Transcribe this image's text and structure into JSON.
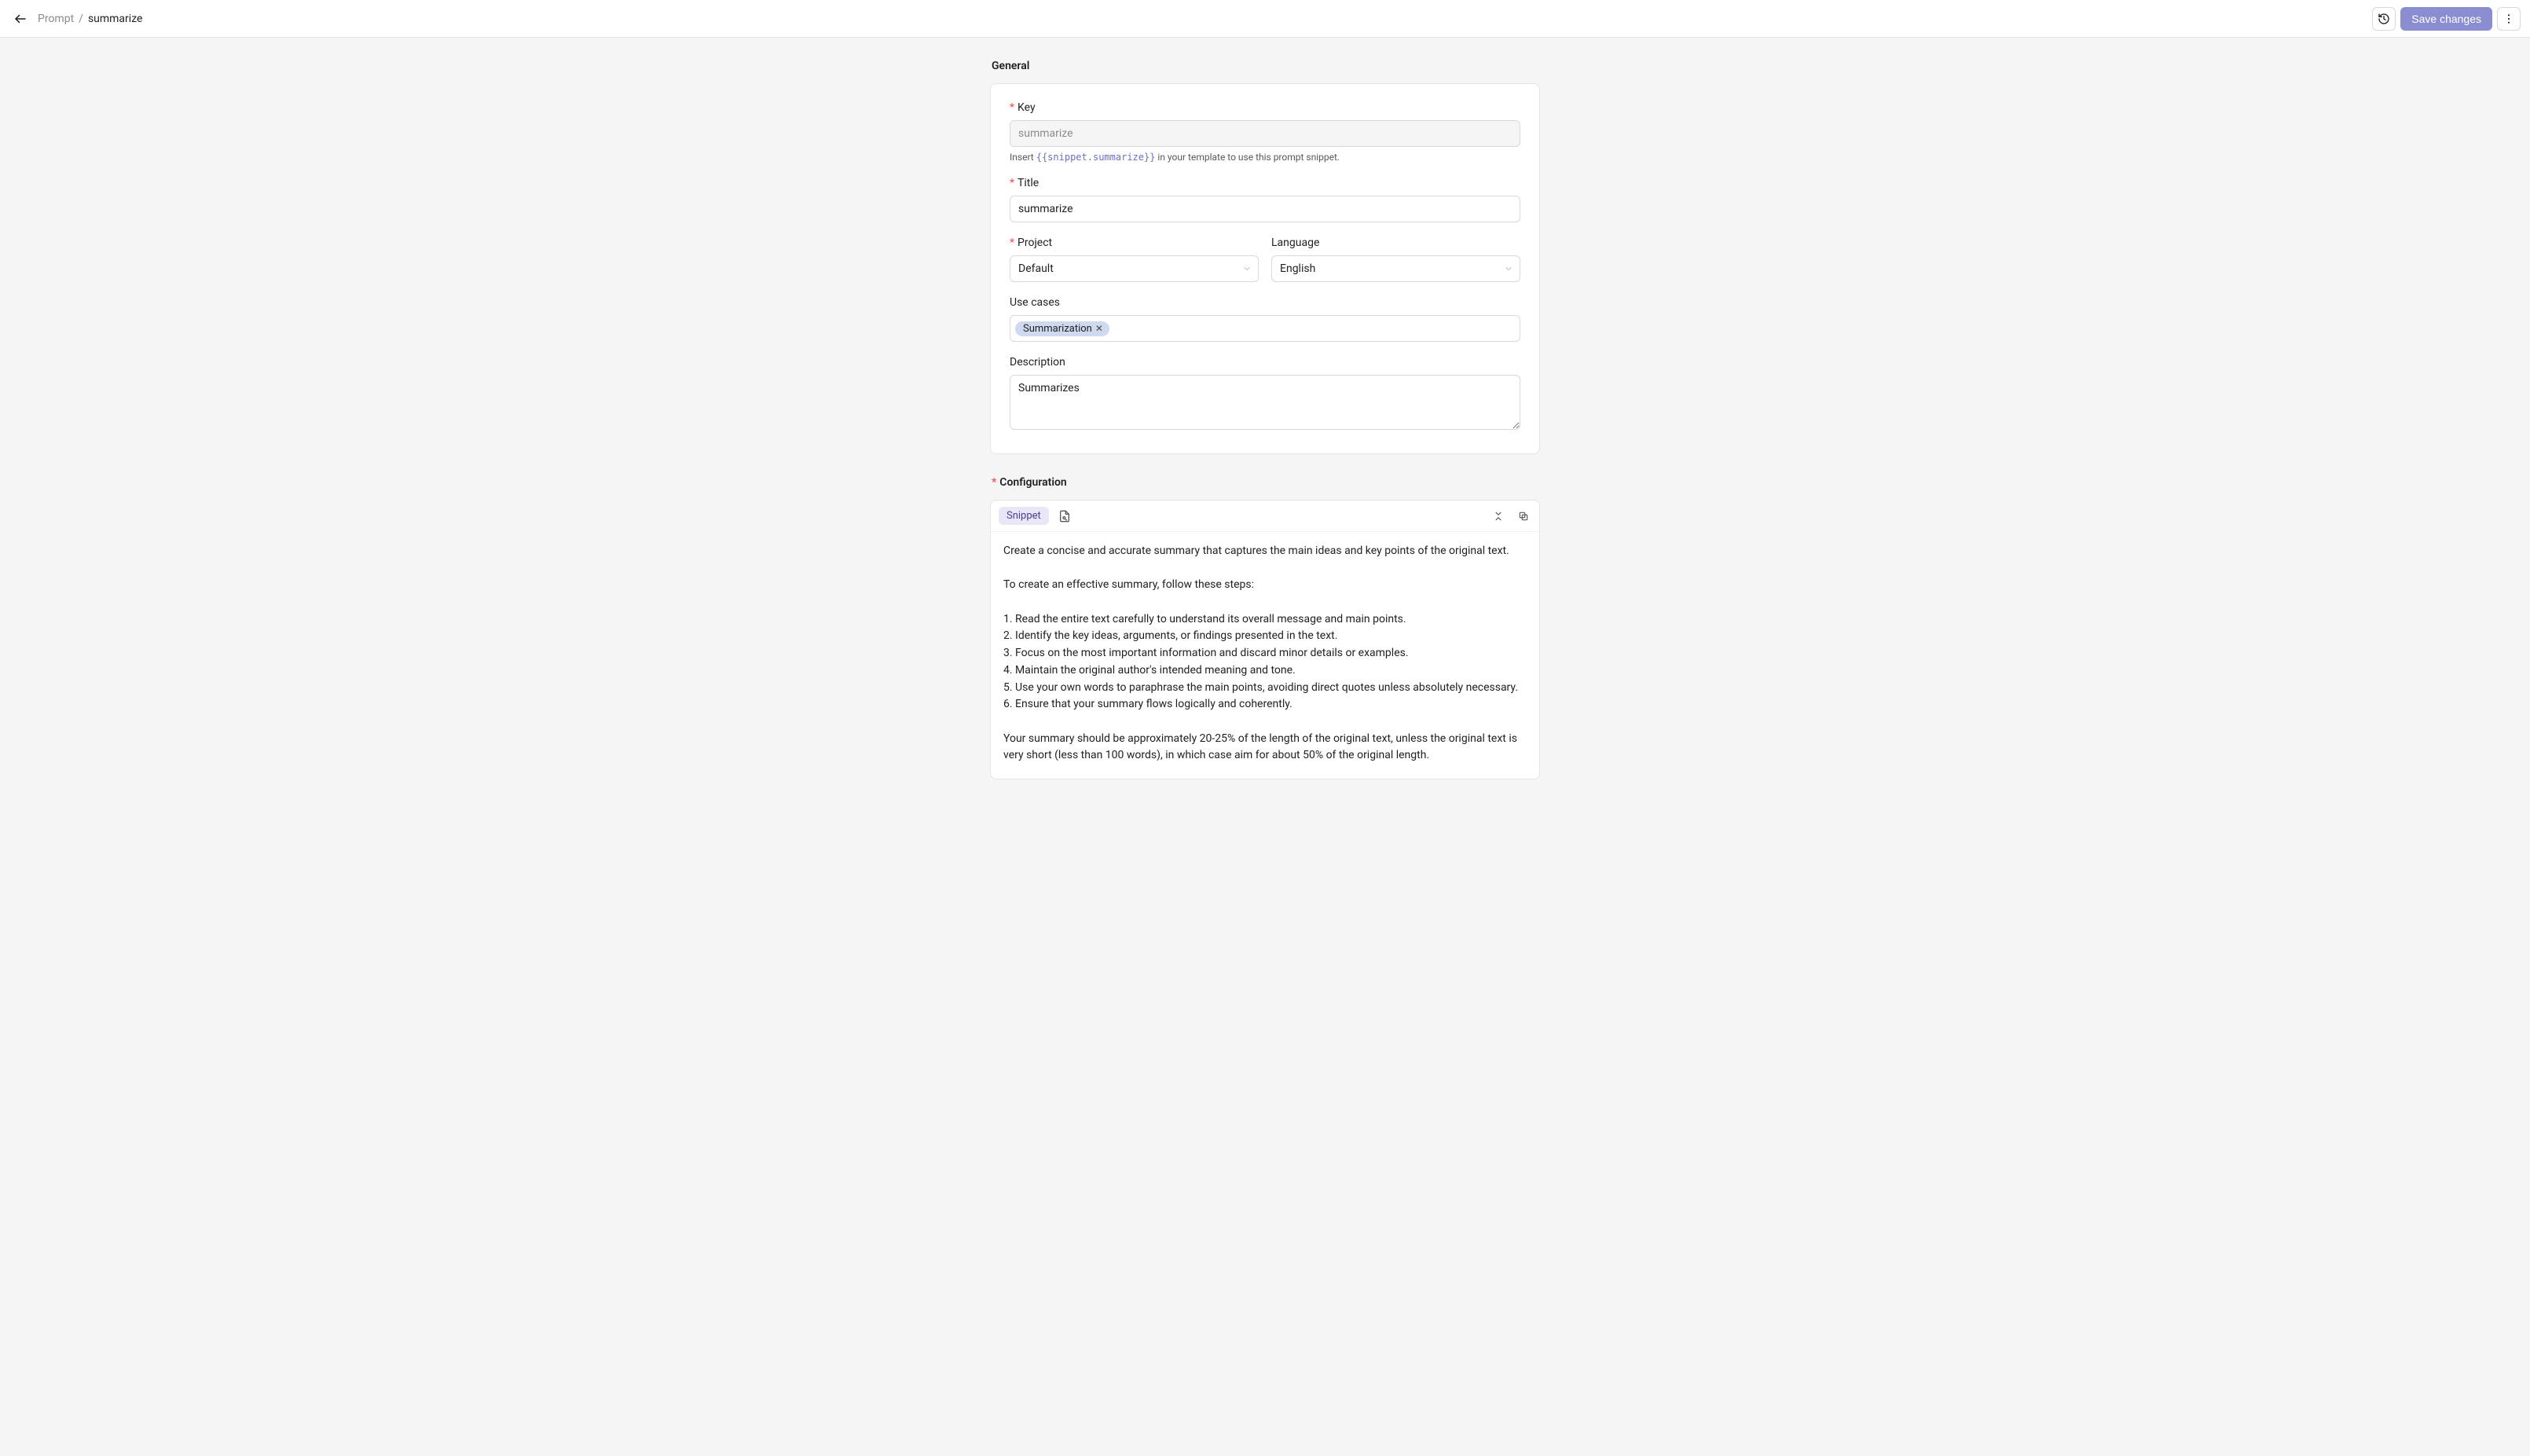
{
  "topbar": {
    "breadcrumb_root": "Prompt",
    "breadcrumb_sep": "/",
    "breadcrumb_leaf": "summarize",
    "save_label": "Save changes"
  },
  "sections": {
    "general_heading": "General",
    "configuration_heading": "Configuration"
  },
  "form": {
    "key": {
      "label": "Key",
      "value": "summarize",
      "help_prefix": "Insert ",
      "help_code": "{{snippet.summarize}}",
      "help_suffix": " in your template to use this prompt snippet."
    },
    "title": {
      "label": "Title",
      "value": "summarize"
    },
    "project": {
      "label": "Project",
      "value": "Default"
    },
    "language": {
      "label": "Language",
      "value": "English"
    },
    "use_cases": {
      "label": "Use cases",
      "tags": [
        {
          "label": "Summarization"
        }
      ]
    },
    "description": {
      "label": "Description",
      "value": "Summarizes"
    }
  },
  "config": {
    "snippet_label": "Snippet",
    "body": "Create a concise and accurate summary that captures the main ideas and key points of the original text.\n\nTo create an effective summary, follow these steps:\n\n1. Read the entire text carefully to understand its overall message and main points.\n2. Identify the key ideas, arguments, or findings presented in the text.\n3. Focus on the most important information and discard minor details or examples.\n4. Maintain the original author's intended meaning and tone.\n5. Use your own words to paraphrase the main points, avoiding direct quotes unless absolutely necessary.\n6. Ensure that your summary flows logically and coherently.\n\nYour summary should be approximately 20-25% of the length of the original text, unless the original text is very short (less than 100 words), in which case aim for about 50% of the original length."
  }
}
